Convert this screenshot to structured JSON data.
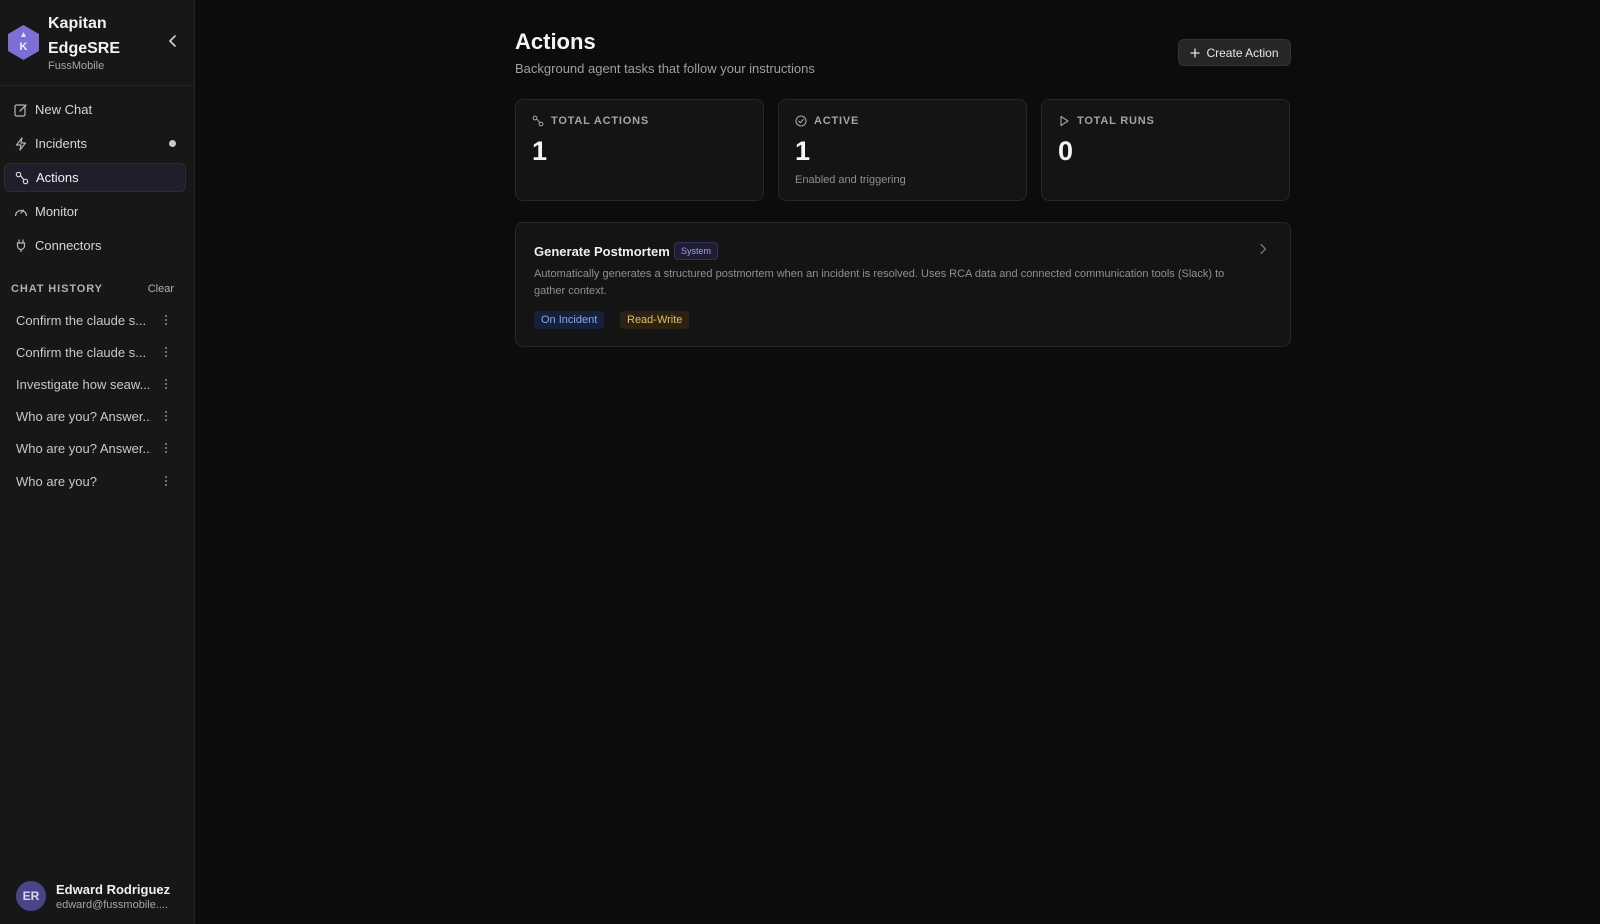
{
  "brand": {
    "logo_letter": "K",
    "title": "Kapitan EdgeSRE",
    "org": "FussMobile",
    "accent": "#7c6fd6"
  },
  "nav": [
    {
      "label": "New Chat",
      "icon": "edit-icon"
    },
    {
      "label": "Incidents",
      "icon": "bolt-icon",
      "indicator": true
    },
    {
      "label": "Actions",
      "icon": "route-icon",
      "active": true
    },
    {
      "label": "Monitor",
      "icon": "gauge-icon"
    },
    {
      "label": "Connectors",
      "icon": "plug-icon"
    }
  ],
  "history": {
    "title": "CHAT HISTORY",
    "clear_label": "Clear",
    "items": [
      "Confirm the claude s...",
      "Confirm the claude s...",
      "Investigate how seaw...",
      "Who are you? Answer...",
      "Who are you? Answer...",
      "Who are you?"
    ]
  },
  "user": {
    "initials": "ER",
    "name": "Edward Rodriguez",
    "email": "edward@fussmobile...."
  },
  "page": {
    "title": "Actions",
    "subtitle": "Background agent tasks that follow your instructions",
    "create_label": "Create Action"
  },
  "stats": [
    {
      "label": "TOTAL ACTIONS",
      "value": "1",
      "hint": "",
      "icon": "route-icon"
    },
    {
      "label": "ACTIVE",
      "value": "1",
      "hint": "Enabled and triggering",
      "icon": "check-circle-icon"
    },
    {
      "label": "TOTAL RUNS",
      "value": "0",
      "hint": "",
      "icon": "play-icon"
    }
  ],
  "actions": [
    {
      "name": "Generate Postmortem",
      "badge": "System",
      "description": "Automatically generates a structured postmortem when an incident is resolved. Uses RCA data and connected communication tools (Slack) to gather context.",
      "trigger": "On Incident",
      "permission": "Read-Write"
    }
  ]
}
